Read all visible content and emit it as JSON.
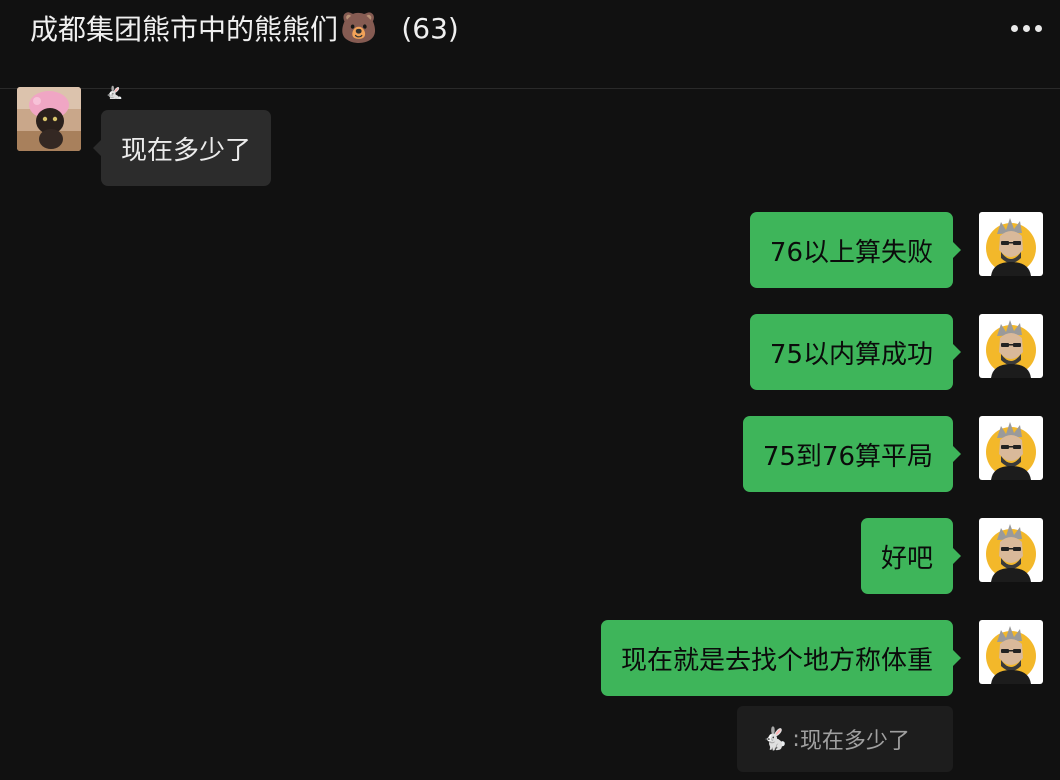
{
  "header": {
    "title": "成都集团熊市中的熊熊们",
    "title_emoji": "🐻",
    "member_count": "(63)",
    "more_icon": "ellipsis-icon"
  },
  "messages": [
    {
      "direction": "incoming",
      "sender_emoji": "🐇",
      "text": "现在多少了",
      "avatar": "cat-avatar"
    },
    {
      "direction": "outgoing",
      "text": "76以上算失败",
      "avatar": "user-avatar"
    },
    {
      "direction": "outgoing",
      "text": "75以内算成功",
      "avatar": "user-avatar"
    },
    {
      "direction": "outgoing",
      "text": "75到76算平局",
      "avatar": "user-avatar"
    },
    {
      "direction": "outgoing",
      "text": "好吧",
      "avatar": "user-avatar"
    },
    {
      "direction": "outgoing",
      "text": "现在就是去找个地方称体重",
      "avatar": "user-avatar"
    }
  ],
  "quote": {
    "sender_emoji": "🐇",
    "separator": ":",
    "text": "现在多少了"
  },
  "colors": {
    "background": "#111111",
    "incoming_bubble": "#2c2c2c",
    "outgoing_bubble": "#3eb55a",
    "quote_bubble": "#1d1d1d"
  }
}
